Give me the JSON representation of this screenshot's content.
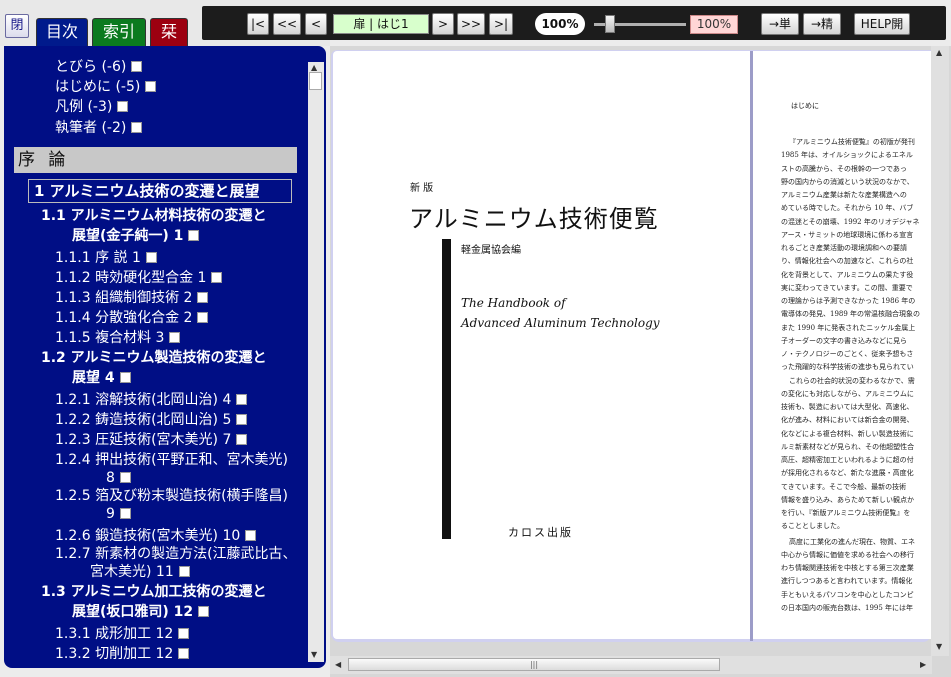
{
  "nav": {
    "close_label": "閉",
    "tabs": [
      "目次",
      "索引",
      "栞"
    ]
  },
  "toolbar": {
    "first": "|<",
    "prev_many": "<<",
    "prev": "<",
    "page": "扉 | はじ1",
    "next": ">",
    "next_many": ">>",
    "last": ">|",
    "zoom": "100%",
    "zoom_field": "100%",
    "zoom_level_pct": 13,
    "single_btn": "→単",
    "fine_btn": "→精",
    "help_btn": "HELP開"
  },
  "toc": {
    "front": [
      {
        "text": "とびら (-6)"
      },
      {
        "text": "はじめに (-5)"
      },
      {
        "text": "凡例 (-3)"
      },
      {
        "text": "執筆者 (-2)"
      }
    ],
    "section": "序 論",
    "chapter": "1 アルミニウム技術の変遷と展望",
    "entries": [
      {
        "text": "1.1 アルミニウム材料技術の変遷と",
        "bold": true
      },
      {
        "text": "展望(金子純一) 1",
        "bold": true,
        "cb": true
      },
      {
        "text": "1.1.1 序 説 1",
        "cb": true
      },
      {
        "text": "1.1.2 時効硬化型合金 1",
        "cb": true
      },
      {
        "text": "1.1.3 組織制御技術 2",
        "cb": true
      },
      {
        "text": "1.1.4 分散強化合金 2",
        "cb": true
      },
      {
        "text": "1.1.5 複合材料 3",
        "cb": true
      },
      {
        "text": "1.2 アルミニウム製造技術の変遷と",
        "bold": true
      },
      {
        "text": "展望 4",
        "bold": true,
        "cb": true
      },
      {
        "text": "1.2.1 溶解技術(北岡山治) 4",
        "cb": true
      },
      {
        "text": "1.2.2 鋳造技術(北岡山治) 5",
        "cb": true
      },
      {
        "text": "1.2.3 圧延技術(宮木美光) 7",
        "cb": true
      },
      {
        "text": "1.2.4 押出技術(平野正和、宮木美光)"
      },
      {
        "text": "8",
        "cb": true
      },
      {
        "text": "1.2.5 箔及び粉末製造技術(横手隆昌)"
      },
      {
        "text": "9",
        "cb": true
      },
      {
        "text": "1.2.6 鍛造技術(宮木美光) 10",
        "cb": true
      },
      {
        "text": "1.2.7 新素材の製造方法(江藤武比古、"
      },
      {
        "text": "宮木美光) 11",
        "cb": true
      },
      {
        "text": "1.3 アルミニウム加工技術の変遷と",
        "bold": true
      },
      {
        "text": "展望(坂口雅司) 12",
        "bold": true,
        "cb": true
      },
      {
        "text": "1.3.1 成形加工 12",
        "cb": true
      },
      {
        "text": "1.3.2 切削加工 12",
        "cb": true
      }
    ]
  },
  "cover": {
    "small": "新 版",
    "title": "アルミニウム技術便覧",
    "publisher": "軽金属協会編",
    "en1": "The Handbook of",
    "en2": "Advanced Aluminum Technology",
    "foot": "カロス出版"
  },
  "right_page": {
    "heading": "はじめに",
    "lines": [
      "『アルミニウム技術便覧』の初版が発刊",
      "1985 年は、オイルショックによるエネル",
      "ストの高騰から、その根幹の一つであっ",
      "野の国内からの消滅という状況のなかで、",
      "アルミニウム産業は新たな産業構造への",
      "めている時でした。それから 10 年、バブ",
      "の混迷とその崩壊、1992 年のリオデジャネ",
      "アース・サミットの地球環境に係わる宣言",
      "れるごとき産業活動の環境調和への要請",
      "り、情報化社会への加速など、これらの社",
      "化を背景として、アルミニウムの果たす役",
      "実に変わってきています。この間、重要で",
      "の理論からは予測できなかった 1986 年の",
      "電導体の発見、1989 年の常温核融合現象の",
      "また 1990 年に発表されたニッケル金属上",
      "子オーダーの文字の書き込みなどに見ら",
      "ノ・テクノロジーのごとく、従来予想もさ",
      "った飛躍的な科学技術の進歩も見られてい",
      "これらの社会的状況の変わるなかで、需",
      "の変化にも対応しながら、アルミニウムに",
      "技術も、製造においては大型化、高速化、",
      "化が進み、材料においては新合金の開発、",
      "化などによる複合材料、新しい製造技術に",
      "ルミ新素材などが見られ、その他超塑性合",
      "高圧、超精密加工といわれるように超の付",
      "が採用化されるなど、新たな進展・高度化",
      "てきています。そこで今般、最新の技術",
      "情報を盛り込み、あらためて新しい観点か",
      "を行い、『新版アルミニウム技術便覧』を",
      "ることとしました。",
      "高度に工業化の進んだ現在、物質、エネ",
      "中心から情報に価値を求める社会への移行",
      "わち情報関連技術を中核とする第三次産業",
      "進行しつつあると言われています。情報化",
      "手ともいえるパソコンを中心としたコンピ",
      "の日本国内の販売台数は、1995 年には年"
    ]
  }
}
